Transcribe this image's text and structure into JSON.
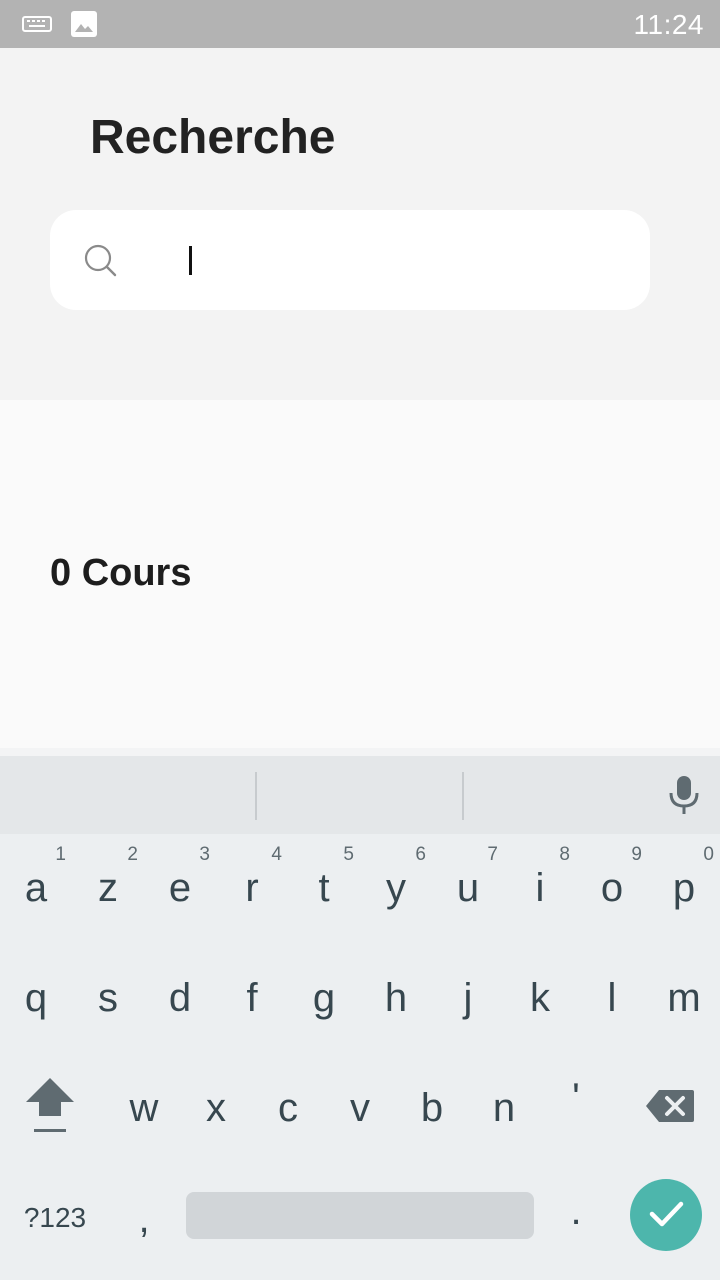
{
  "status_bar": {
    "time": "11:24",
    "icons": [
      "keyboard-icon",
      "image-icon"
    ],
    "background": "#b3b3b3"
  },
  "header": {
    "title": "Recherche"
  },
  "search": {
    "value": "",
    "icon": "search-icon"
  },
  "content": {
    "course_count": "0 Cours"
  },
  "keyboard": {
    "row1": [
      {
        "label": "a",
        "hint": "1"
      },
      {
        "label": "z",
        "hint": "2"
      },
      {
        "label": "e",
        "hint": "3"
      },
      {
        "label": "r",
        "hint": "4"
      },
      {
        "label": "t",
        "hint": "5"
      },
      {
        "label": "y",
        "hint": "6"
      },
      {
        "label": "u",
        "hint": "7"
      },
      {
        "label": "i",
        "hint": "8"
      },
      {
        "label": "o",
        "hint": "9"
      },
      {
        "label": "p",
        "hint": "0"
      }
    ],
    "row2": [
      "q",
      "s",
      "d",
      "f",
      "g",
      "h",
      "j",
      "k",
      "l",
      "m"
    ],
    "row3": [
      "w",
      "x",
      "c",
      "v",
      "b",
      "n",
      "'"
    ],
    "mode_label": "?123",
    "comma": ",",
    "period": ".",
    "enter_color": "#4db6ac",
    "icons": [
      "shift-icon",
      "backspace-icon",
      "mic-icon",
      "check-icon"
    ]
  }
}
